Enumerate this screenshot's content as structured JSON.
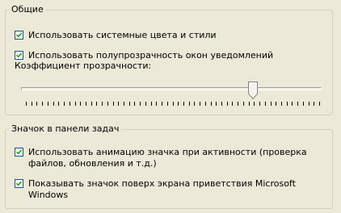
{
  "general": {
    "title": "Общие",
    "options": [
      {
        "label": "Использовать системные цвета и стили",
        "checked": true
      },
      {
        "label": "Использовать полупрозрачность окон уведомлений",
        "checked": true
      }
    ],
    "transparency": {
      "label": "Коэффициент прозрачности:",
      "value": 0.78,
      "tick_count": 55
    }
  },
  "tray": {
    "title": "Значок в панели задач",
    "options": [
      {
        "label": "Использовать анимацию значка при активности (проверка файлов, обновления и т.д.)",
        "checked": true
      },
      {
        "label": "Показывать значок поверх экрана приветствия Microsoft Windows",
        "checked": true
      }
    ]
  }
}
